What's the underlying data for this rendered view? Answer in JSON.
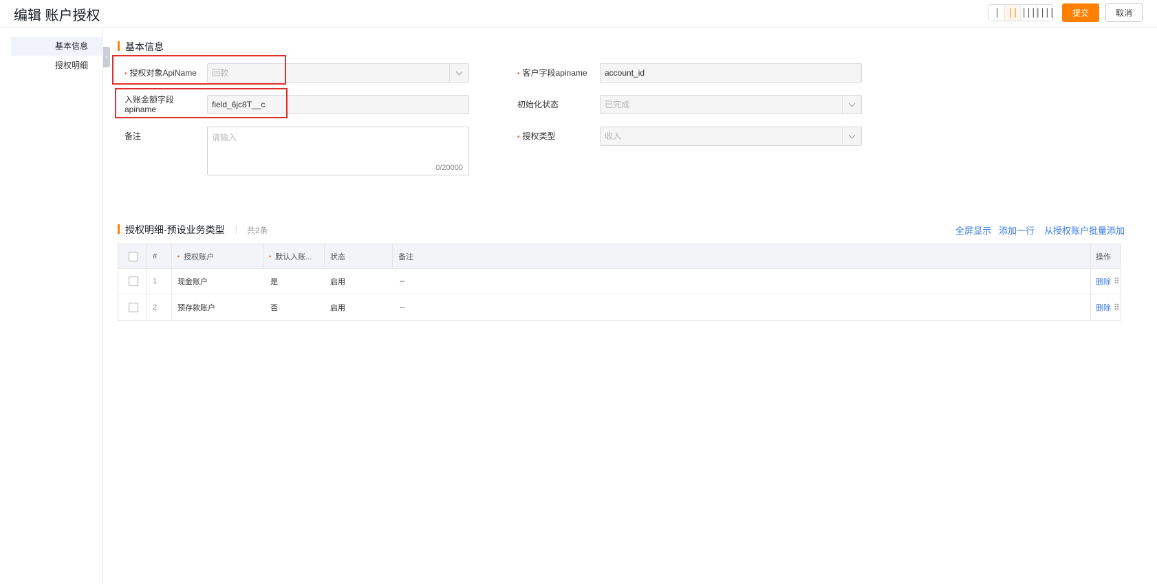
{
  "header": {
    "title": "编辑 账户授权",
    "layout_buttons": [
      "|",
      "||",
      "|||",
      "||||"
    ],
    "submit_label": "提交",
    "cancel_label": "取消"
  },
  "sidebar": {
    "items": [
      {
        "label": "基本信息",
        "active": true
      },
      {
        "label": "授权明细",
        "active": false
      }
    ],
    "collapse_glyph": "‹"
  },
  "basic": {
    "title": "基本信息",
    "fields": {
      "object_api": {
        "label": "授权对象ApiName",
        "required": true,
        "value": "回款"
      },
      "customer_field": {
        "label": "客户字段apiname",
        "required": true,
        "value": "account_id"
      },
      "amount_field": {
        "label_line1": "入账金额字段",
        "label_line2": "apiname",
        "required": false,
        "value": "field_6jc8T__c"
      },
      "init_status": {
        "label": "初始化状态",
        "required": false,
        "value": "已完成"
      },
      "remark": {
        "label": "备注",
        "required": false,
        "placeholder": "请输入",
        "count": "0/20000"
      },
      "auth_type": {
        "label": "授权类型",
        "required": true,
        "value": "收入"
      }
    }
  },
  "detail": {
    "title": "授权明细-预设业务类型",
    "count_text": "共2条",
    "actions": [
      "全屏显示",
      "添加一行",
      "从授权账户批量添加"
    ],
    "columns": [
      "#",
      "授权账户",
      "默认入账...",
      "状态",
      "备注",
      "操作"
    ],
    "rows": [
      {
        "index": "1",
        "account": "现金账户",
        "default": "是",
        "status": "启用",
        "remark": "--",
        "action": "删除"
      },
      {
        "index": "2",
        "account": "预存款账户",
        "default": "否",
        "status": "启用",
        "remark": "--",
        "action": "删除"
      }
    ],
    "drag_glyph": "⠿"
  },
  "colors": {
    "accent": "#ff8000",
    "link": "#3a7be0",
    "required": "#ff522a",
    "highlight_box": "#e22d2d"
  }
}
